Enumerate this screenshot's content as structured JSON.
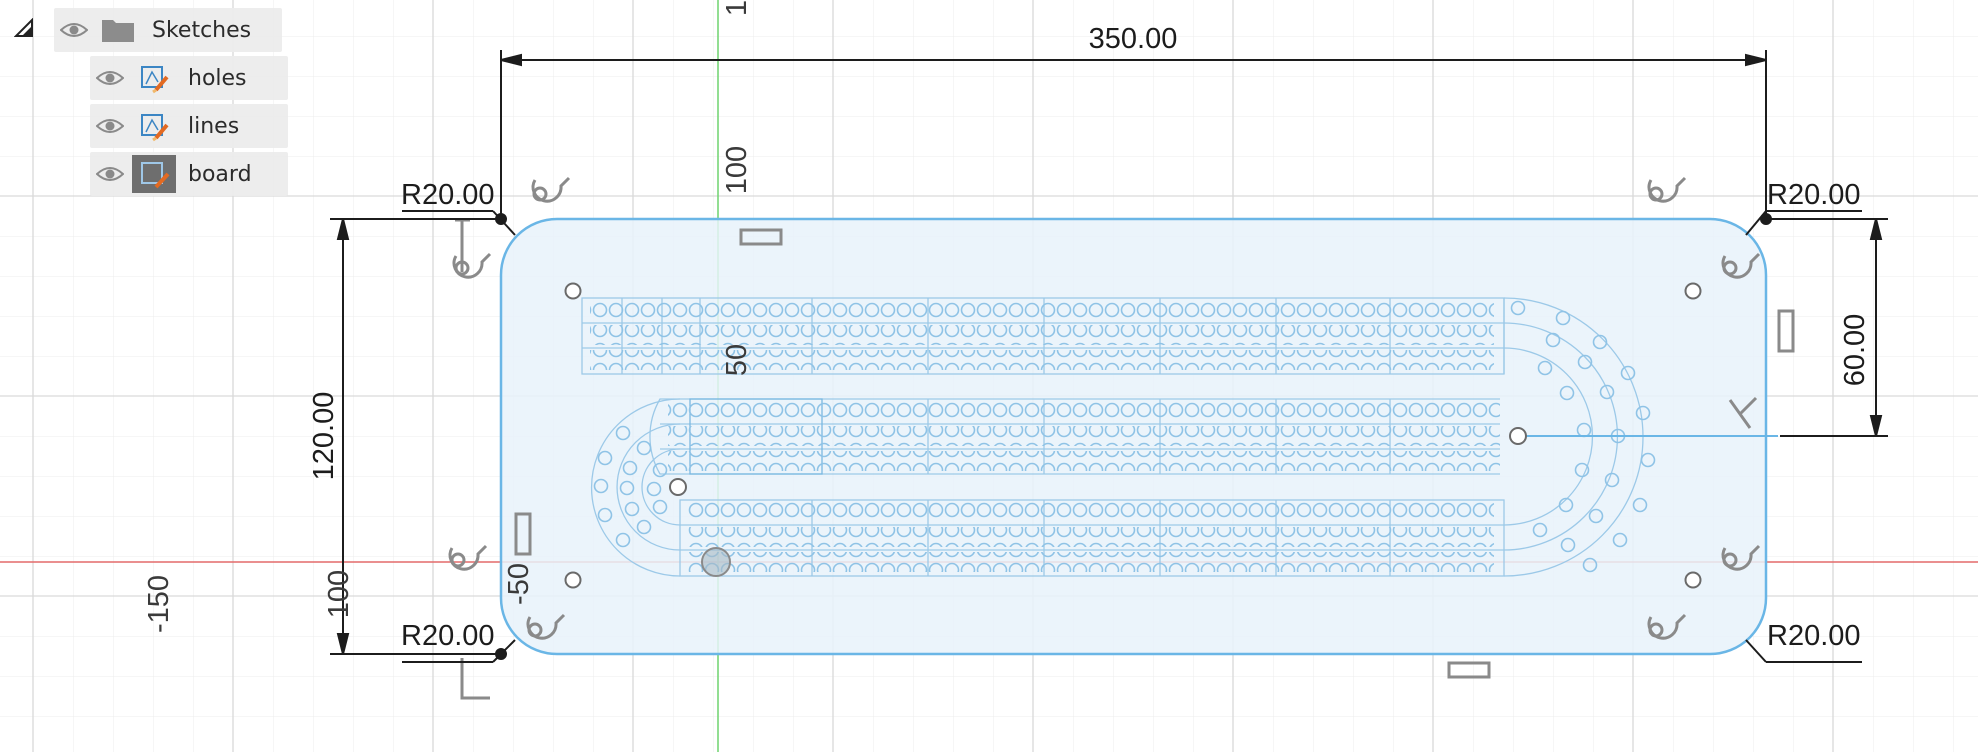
{
  "browser": {
    "folder": {
      "label": "Sketches"
    },
    "sketches": [
      {
        "label": "holes"
      },
      {
        "label": "lines"
      },
      {
        "label": "board"
      }
    ]
  },
  "dimensions": {
    "width": "350.00",
    "height": "120.00",
    "right_offset": "60.00",
    "radius_top_left": "R20.00",
    "radius_top_right": "R20.00",
    "radius_bottom_left": "R20.00",
    "radius_bottom_right": "R20.00"
  },
  "grid_labels": {
    "y100": "100",
    "y50": "50",
    "y_neg50": "-50",
    "x_neg150": "-150",
    "x_neg100": "100",
    "top_partial": "1"
  },
  "colors": {
    "board_fill": "#e7f1f9",
    "board_stroke": "#6fb8e6",
    "x_axis": "#e05b5b",
    "y_axis": "#5bc95b",
    "grid": "#e3e3e3"
  }
}
